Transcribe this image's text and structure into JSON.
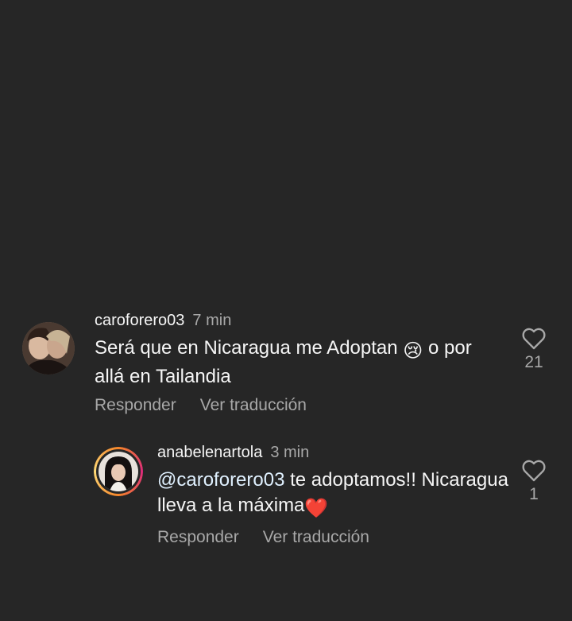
{
  "comments": [
    {
      "username": "caroforero03",
      "time": "7 min",
      "text_line1": "Será que en Nicaragua me Adoptan",
      "text_emoji": "😢",
      "text_line2": "o por allá en Tailandia",
      "reply_label": "Responder",
      "translate_label": "Ver traducción",
      "likes": "21",
      "avatar_icon": "profile-photo"
    },
    {
      "username": "anabelenartola",
      "time": "3 min",
      "mention": "@caroforero03",
      "text_rest": " te adoptamos!! Nicaragua lleva a la máxima",
      "text_emoji": "❤️",
      "reply_label": "Responder",
      "translate_label": "Ver traducción",
      "likes": "1",
      "avatar_icon": "profile-photo-story-ring"
    }
  ],
  "colors": {
    "background": "#262626",
    "primary_text": "#f5f5f5",
    "secondary_text": "#a8a8a8",
    "heart_emoji": "#e0245e"
  }
}
